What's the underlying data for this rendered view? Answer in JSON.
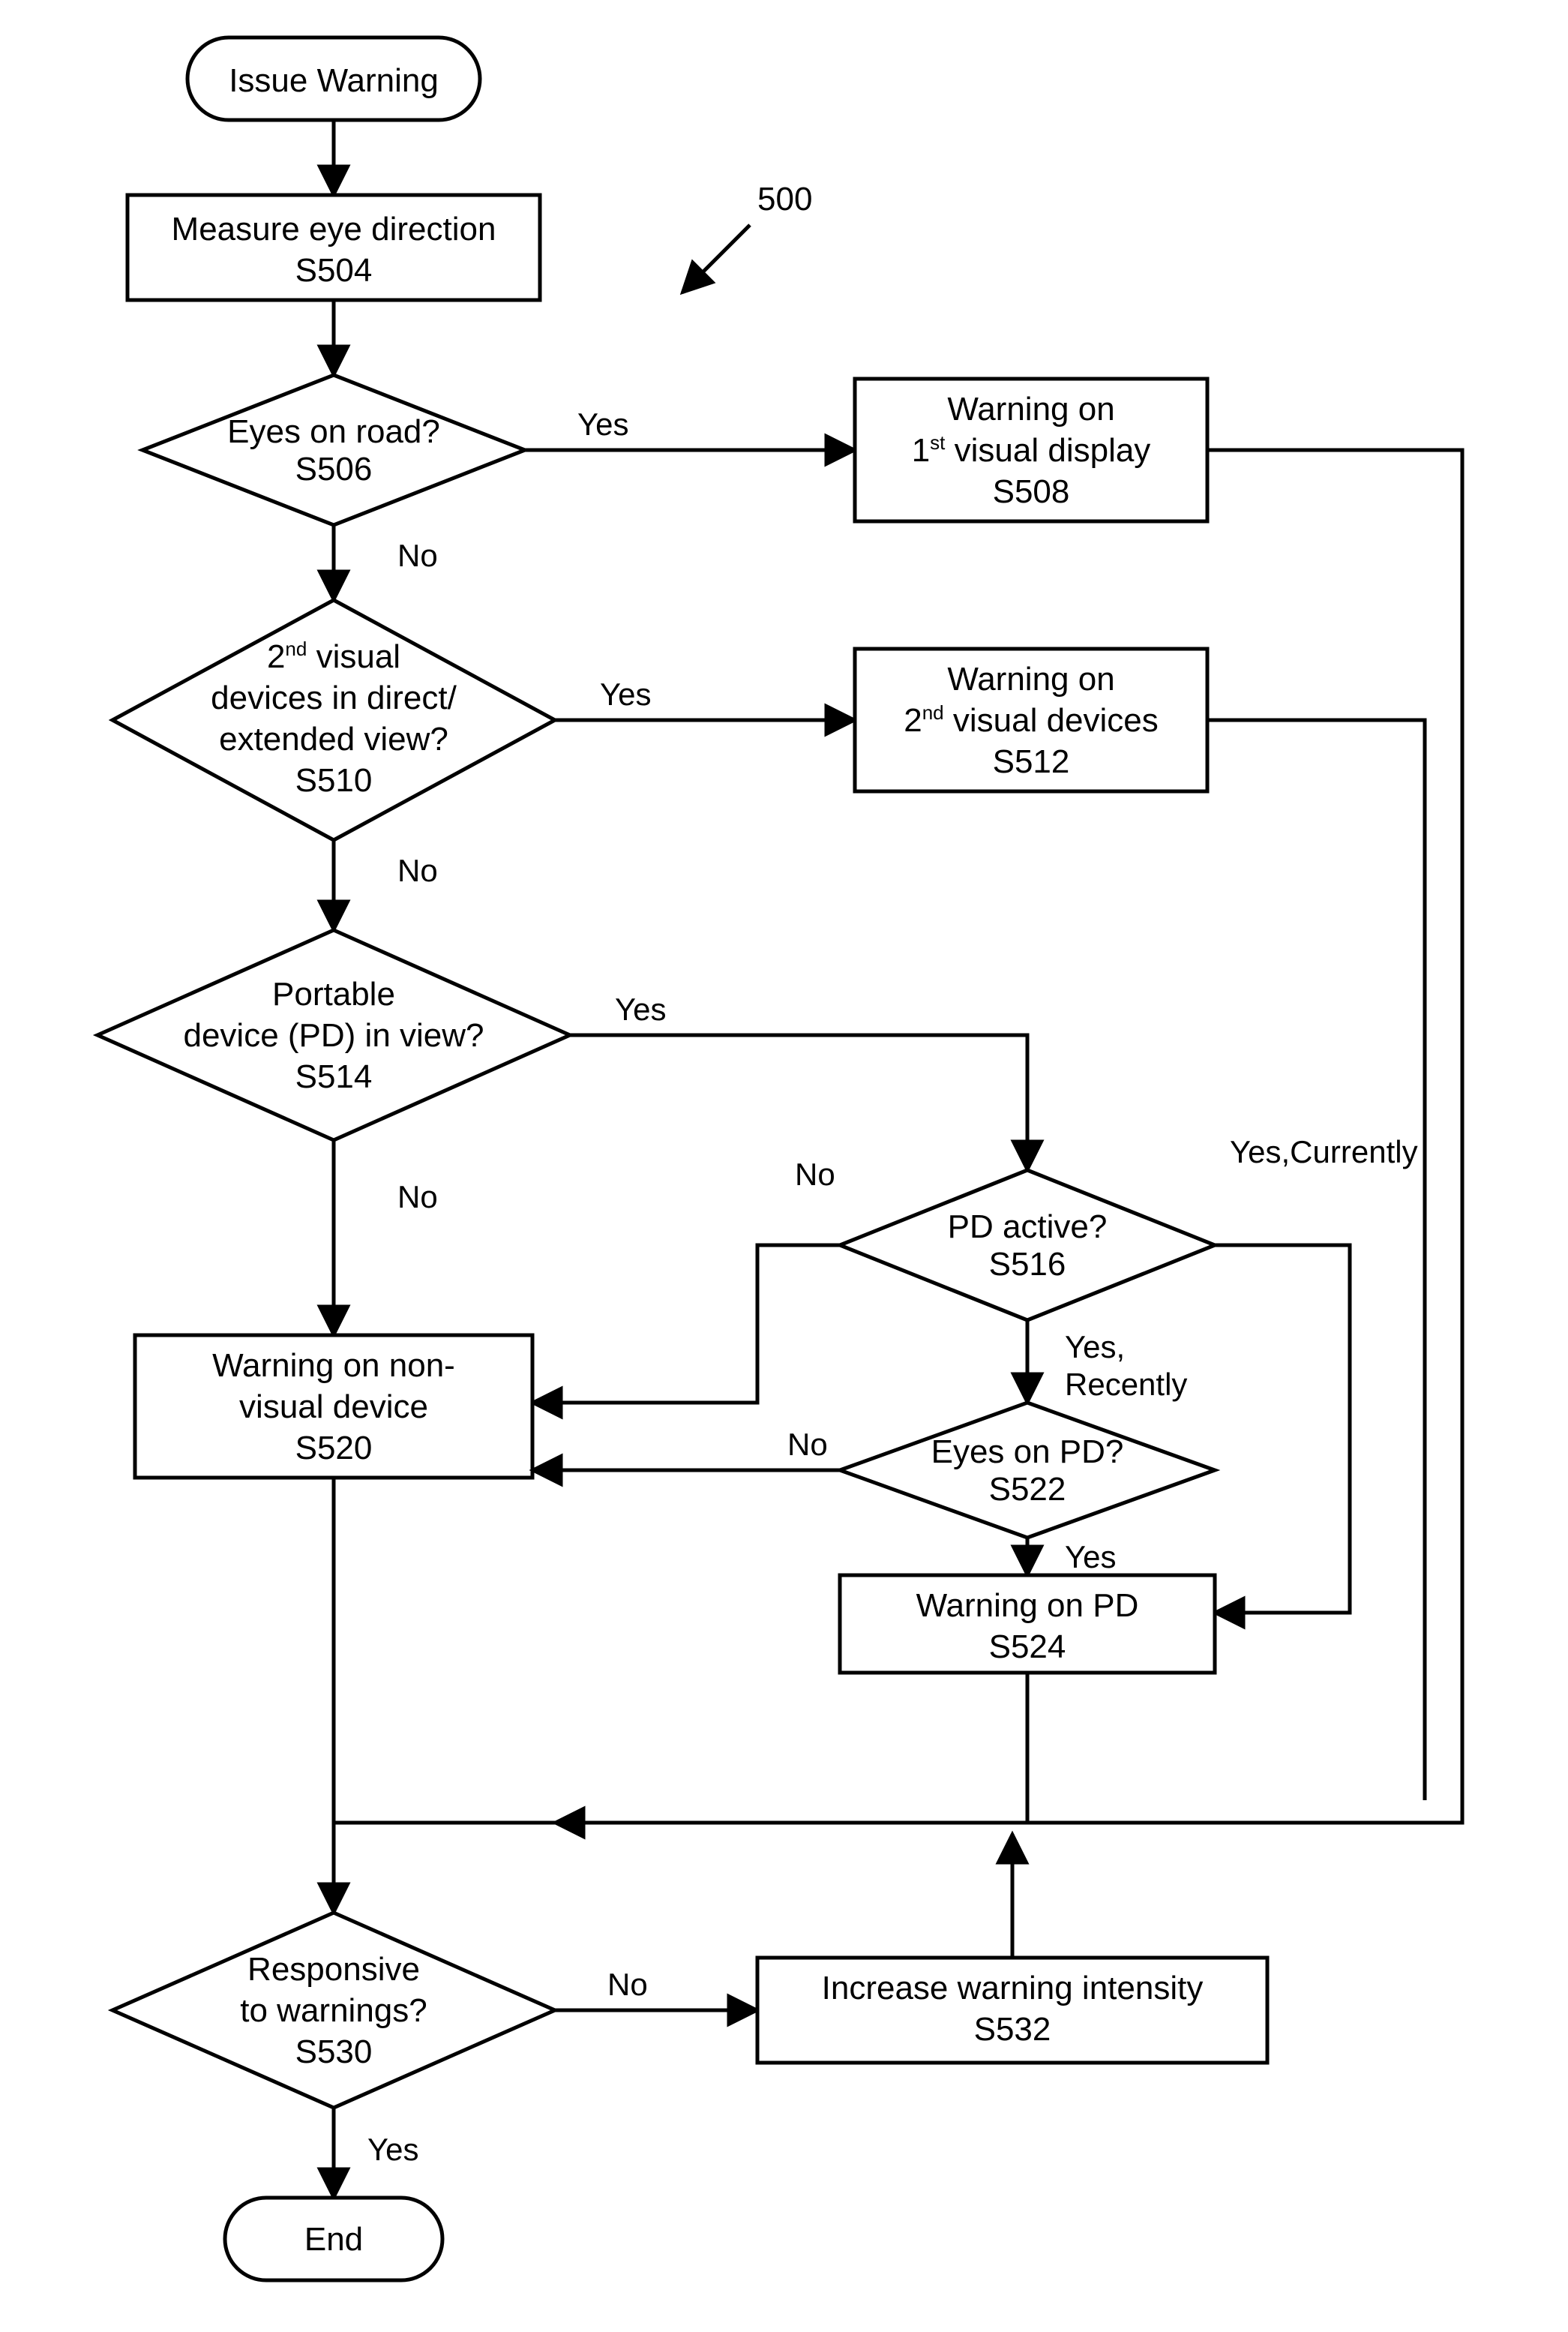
{
  "chart_data": {
    "type": "flowchart",
    "reference_number": "500",
    "nodes": [
      {
        "id": "start",
        "shape": "terminator",
        "label": "Issue Warning"
      },
      {
        "id": "s504",
        "shape": "process",
        "label": "Measure eye direction",
        "code": "S504"
      },
      {
        "id": "s506",
        "shape": "decision",
        "label": "Eyes on road?",
        "code": "S506"
      },
      {
        "id": "s508",
        "shape": "process",
        "label": "Warning on 1st visual display",
        "code": "S508"
      },
      {
        "id": "s510",
        "shape": "decision",
        "label": "2nd visual devices in direct/ extended view?",
        "code": "S510"
      },
      {
        "id": "s512",
        "shape": "process",
        "label": "Warning on 2nd visual devices",
        "code": "S512"
      },
      {
        "id": "s514",
        "shape": "decision",
        "label": "Portable device (PD) in view?",
        "code": "S514"
      },
      {
        "id": "s516",
        "shape": "decision",
        "label": "PD active?",
        "code": "S516"
      },
      {
        "id": "s520",
        "shape": "process",
        "label": "Warning on non-visual device",
        "code": "S520"
      },
      {
        "id": "s522",
        "shape": "decision",
        "label": "Eyes on PD?",
        "code": "S522"
      },
      {
        "id": "s524",
        "shape": "process",
        "label": "Warning on PD",
        "code": "S524"
      },
      {
        "id": "s530",
        "shape": "decision",
        "label": "Responsive to warnings?",
        "code": "S530"
      },
      {
        "id": "s532",
        "shape": "process",
        "label": "Increase warning intensity",
        "code": "S532"
      },
      {
        "id": "end",
        "shape": "terminator",
        "label": "End"
      }
    ],
    "edges": [
      {
        "from": "start",
        "to": "s504"
      },
      {
        "from": "s504",
        "to": "s506"
      },
      {
        "from": "s506",
        "to": "s508",
        "label": "Yes"
      },
      {
        "from": "s506",
        "to": "s510",
        "label": "No"
      },
      {
        "from": "s510",
        "to": "s512",
        "label": "Yes"
      },
      {
        "from": "s510",
        "to": "s514",
        "label": "No"
      },
      {
        "from": "s514",
        "to": "s516",
        "label": "Yes"
      },
      {
        "from": "s514",
        "to": "s520",
        "label": "No"
      },
      {
        "from": "s516",
        "to": "s520",
        "label": "No"
      },
      {
        "from": "s516",
        "to": "s524",
        "label": "Yes,Currently"
      },
      {
        "from": "s516",
        "to": "s522",
        "label": "Yes, Recently"
      },
      {
        "from": "s522",
        "to": "s520",
        "label": "No"
      },
      {
        "from": "s522",
        "to": "s524",
        "label": "Yes"
      },
      {
        "from": "s508",
        "to": "s530"
      },
      {
        "from": "s512",
        "to": "s530"
      },
      {
        "from": "s520",
        "to": "s530"
      },
      {
        "from": "s524",
        "to": "s530"
      },
      {
        "from": "s530",
        "to": "s532",
        "label": "No"
      },
      {
        "from": "s530",
        "to": "end",
        "label": "Yes"
      },
      {
        "from": "s532",
        "to": "s504",
        "note": "loop back via right margin"
      }
    ]
  },
  "ref": "500",
  "start": "Issue Warning",
  "end": "End",
  "s504": {
    "l1": "Measure eye direction",
    "l2": "S504"
  },
  "s506": {
    "l1": "Eyes on road?",
    "l2": "S506"
  },
  "s508": {
    "l1": "Warning on",
    "l2": "1",
    "sup": "st",
    "l2b": " visual display",
    "l3": "S508"
  },
  "s510": {
    "l1": "2",
    "sup": "nd",
    "l1b": " visual",
    "l2": "devices in direct/",
    "l3": "extended view?",
    "l4": "S510"
  },
  "s512": {
    "l1": "Warning on",
    "l2": "2",
    "sup": "nd",
    "l2b": " visual devices",
    "l3": "S512"
  },
  "s514": {
    "l1": "Portable",
    "l2": "device (PD) in view?",
    "l3": "S514"
  },
  "s516": {
    "l1": "PD active?",
    "l2": "S516"
  },
  "s520": {
    "l1": "Warning on non-",
    "l2": "visual device",
    "l3": "S520"
  },
  "s522": {
    "l1": "Eyes on PD?",
    "l2": "S522"
  },
  "s524": {
    "l1": "Warning on PD",
    "l2": "S524"
  },
  "s530": {
    "l1": "Responsive",
    "l2": "to warnings?",
    "l3": "S530"
  },
  "s532": {
    "l1": "Increase warning intensity",
    "l2": "S532"
  },
  "labels": {
    "yes": "Yes",
    "no": "No",
    "yesCurrently": "Yes,Currently",
    "yesRecently1": "Yes,",
    "yesRecently2": "Recently"
  }
}
